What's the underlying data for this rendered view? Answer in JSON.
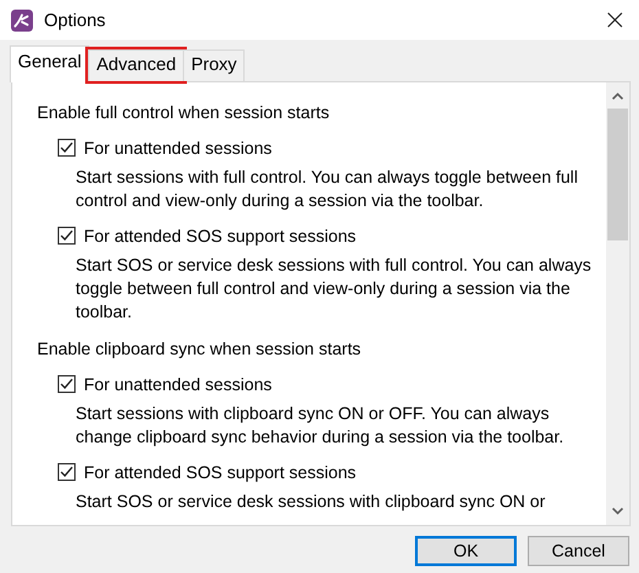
{
  "window": {
    "title": "Options"
  },
  "tabs": [
    {
      "label": "General",
      "selected": true,
      "highlighted": false
    },
    {
      "label": "Advanced",
      "selected": false,
      "highlighted": true
    },
    {
      "label": "Proxy",
      "selected": false,
      "highlighted": false
    }
  ],
  "sections": [
    {
      "title": "Enable full control when session starts",
      "options": [
        {
          "label": "For unattended sessions",
          "checked": true,
          "description": "Start sessions with full control. You can always toggle between full control and view-only during a session via the toolbar."
        },
        {
          "label": "For attended SOS support sessions",
          "checked": true,
          "description": "Start SOS or service desk sessions with full control. You can always toggle between full control and view-only during a session via the toolbar."
        }
      ]
    },
    {
      "title": "Enable clipboard sync when session starts",
      "options": [
        {
          "label": "For unattended sessions",
          "checked": true,
          "description": "Start sessions with clipboard sync ON or OFF. You can always change clipboard sync behavior during a session via the toolbar."
        },
        {
          "label": "For attended SOS support sessions",
          "checked": true,
          "description": "Start SOS or service desk sessions with clipboard sync ON or"
        }
      ]
    }
  ],
  "buttons": [
    {
      "label": "OK",
      "kind": "default"
    },
    {
      "label": "Cancel",
      "kind": "normal"
    }
  ]
}
